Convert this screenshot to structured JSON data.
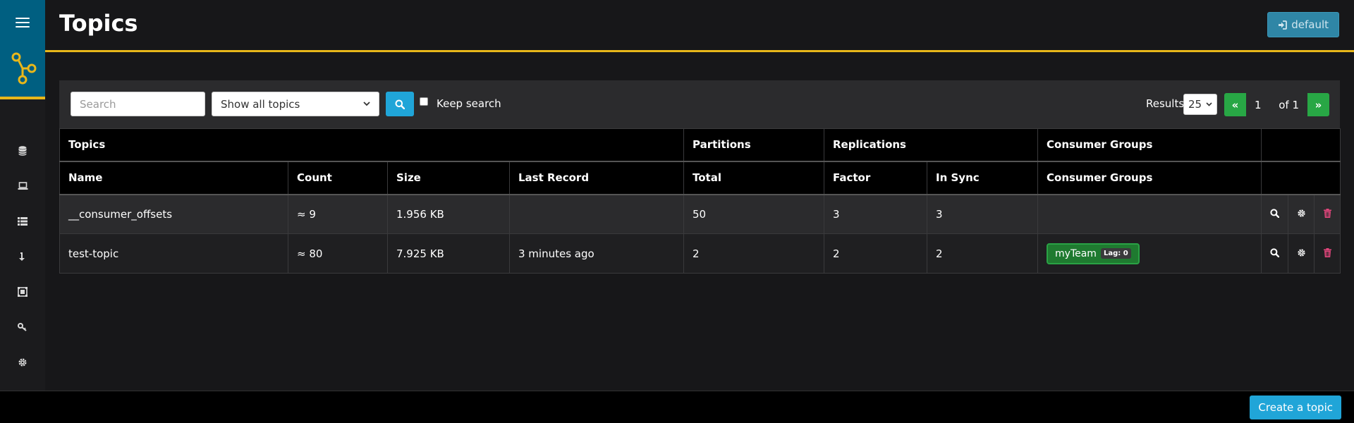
{
  "header": {
    "title": "Topics",
    "cluster_button": "default"
  },
  "toolbar": {
    "search_placeholder": "Search",
    "search_value": "",
    "topic_filter": "Show all topics",
    "keep_search_label": "Keep search",
    "keep_search_checked": false,
    "results_label": "Results",
    "results_per_page": "25",
    "pagination": {
      "prev": "«",
      "current_page": "1",
      "of_label": "of 1",
      "next": "»"
    }
  },
  "table": {
    "group_headers": {
      "topics": "Topics",
      "partitions": "Partitions",
      "replications": "Replications",
      "consumer_groups": "Consumer Groups"
    },
    "columns": {
      "name": "Name",
      "count": "Count",
      "size": "Size",
      "last_record": "Last Record",
      "total": "Total",
      "factor": "Factor",
      "in_sync": "In Sync",
      "consumer_groups": "Consumer Groups"
    },
    "rows": [
      {
        "name": "__consumer_offsets",
        "count": "≈ 9",
        "size": "1.956 KB",
        "last_record": "",
        "total": "50",
        "factor": "3",
        "in_sync": "3",
        "consumer_group": "",
        "lag": ""
      },
      {
        "name": "test-topic",
        "count": "≈ 80",
        "size": "7.925 KB",
        "last_record": "3 minutes ago",
        "total": "2",
        "factor": "2",
        "in_sync": "2",
        "consumer_group": "myTeam",
        "lag": "Lag: 0"
      }
    ]
  },
  "footer": {
    "create_button": "Create a topic"
  },
  "icons": {
    "sidebar": [
      "database-icon",
      "laptop-icon",
      "list-icon",
      "download-arrow-icon",
      "schema-icon",
      "key-icon",
      "gear-icon"
    ],
    "row_actions": [
      "search-icon",
      "gear-icon",
      "trash-icon"
    ]
  },
  "colors": {
    "accent": "#e8b71a",
    "brand": "#005f81",
    "primary": "#20a5d8",
    "success": "#28a745",
    "danger": "#e0457b"
  }
}
